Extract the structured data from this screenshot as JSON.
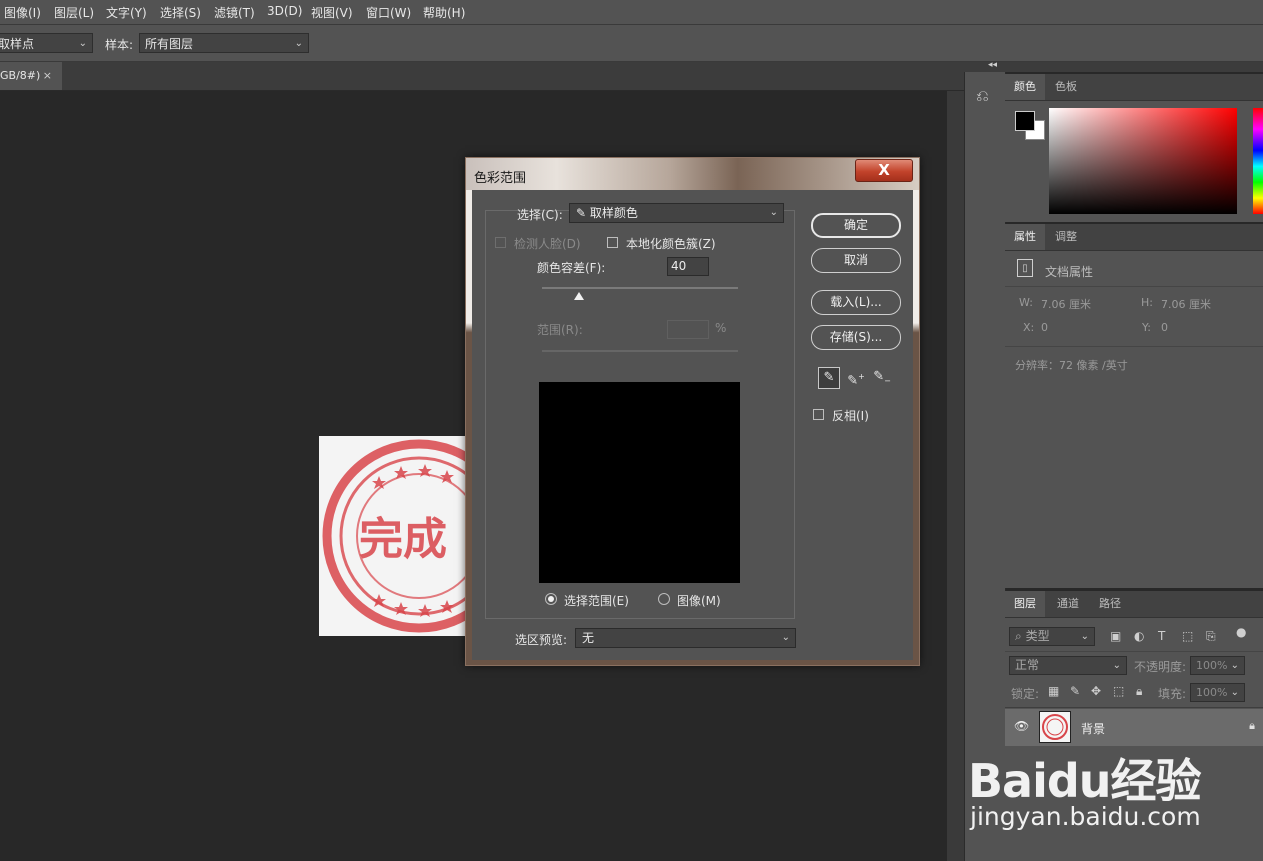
{
  "menubar": {
    "items": [
      "图像(I)",
      "图层(L)",
      "文字(Y)",
      "选择(S)",
      "滤镜(T)",
      "3D(D)",
      "视图(V)",
      "窗口(W)",
      "帮助(H)"
    ]
  },
  "options_bar": {
    "sample_size_value": "取样点",
    "sample_label": "样本:",
    "sample_value": "所有图层"
  },
  "document_tab": {
    "label": "GB/8#)",
    "close": "×"
  },
  "color_panel": {
    "tabs": [
      "颜色",
      "色板"
    ],
    "foreground_color": "#000000",
    "background_color": "#ffffff",
    "hue_color": "#ff0000"
  },
  "properties_panel": {
    "tabs": [
      "属性",
      "调整"
    ],
    "doc_props_label": "文档属性",
    "w_label": "W:",
    "w_value": "7.06 厘米",
    "h_label": "H:",
    "h_value": "7.06 厘米",
    "x_label": "X:",
    "x_value": "0",
    "y_label": "Y:",
    "y_value": "0",
    "resolution": "分辨率：72 像素 /英寸"
  },
  "layers_panel": {
    "tabs": [
      "图层",
      "通道",
      "路径"
    ],
    "filter_type": "类型",
    "blend_mode": "正常",
    "opacity_label": "不透明度:",
    "opacity_value": "100%",
    "lock_label": "锁定:",
    "fill_label": "填充:",
    "fill_value": "100%",
    "layers": [
      {
        "name": "背景",
        "visible": true,
        "locked": true
      }
    ]
  },
  "canvas_image": {
    "stamp_text": "完成"
  },
  "dialog": {
    "title": "色彩范围",
    "close": "X",
    "select_label": "选择(C):",
    "select_value": "取样颜色",
    "detect_faces_label": "检测人脸(D)",
    "localized_label": "本地化颜色簇(Z)",
    "fuzziness_label": "颜色容差(F):",
    "fuzziness_value": "40",
    "fuzziness_fraction": 0.19,
    "range_label": "范围(R):",
    "range_value": "",
    "range_unit": "%",
    "radio_selection": "选择范围(E)",
    "radio_image": "图像(M)",
    "preview_label": "选区预览:",
    "preview_value": "无",
    "buttons": {
      "ok": "确定",
      "cancel": "取消",
      "load": "载入(L)...",
      "save": "存储(S)..."
    },
    "invert_label": "反相(I)"
  },
  "watermark": {
    "brand": "Baidu经验",
    "url": "jingyan.baidu.com"
  }
}
